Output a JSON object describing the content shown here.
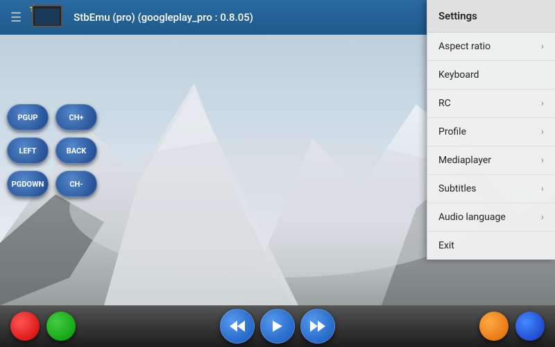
{
  "toolbar": {
    "menu_icon": "☰",
    "star": "★",
    "title": "StbEmu (pro) (googleplay_pro : 0.8.05)"
  },
  "controls": {
    "rows": [
      [
        "PGUP",
        "CH+"
      ],
      [
        "LEFT",
        "BACK"
      ],
      [
        "PGDOWN",
        "CH-"
      ]
    ]
  },
  "settings_menu": {
    "header": "Settings",
    "items": [
      {
        "label": "Aspect ratio",
        "has_arrow": true
      },
      {
        "label": "Keyboard",
        "has_arrow": false
      },
      {
        "label": "RC",
        "has_arrow": true
      },
      {
        "label": "Profile",
        "has_arrow": true
      },
      {
        "label": "Mediaplayer",
        "has_arrow": true
      },
      {
        "label": "Subtitles",
        "has_arrow": true
      },
      {
        "label": "Audio language",
        "has_arrow": true
      }
    ],
    "exit_label": "Exit"
  },
  "nav": {
    "back": "◁",
    "home": "○",
    "square": "□"
  }
}
